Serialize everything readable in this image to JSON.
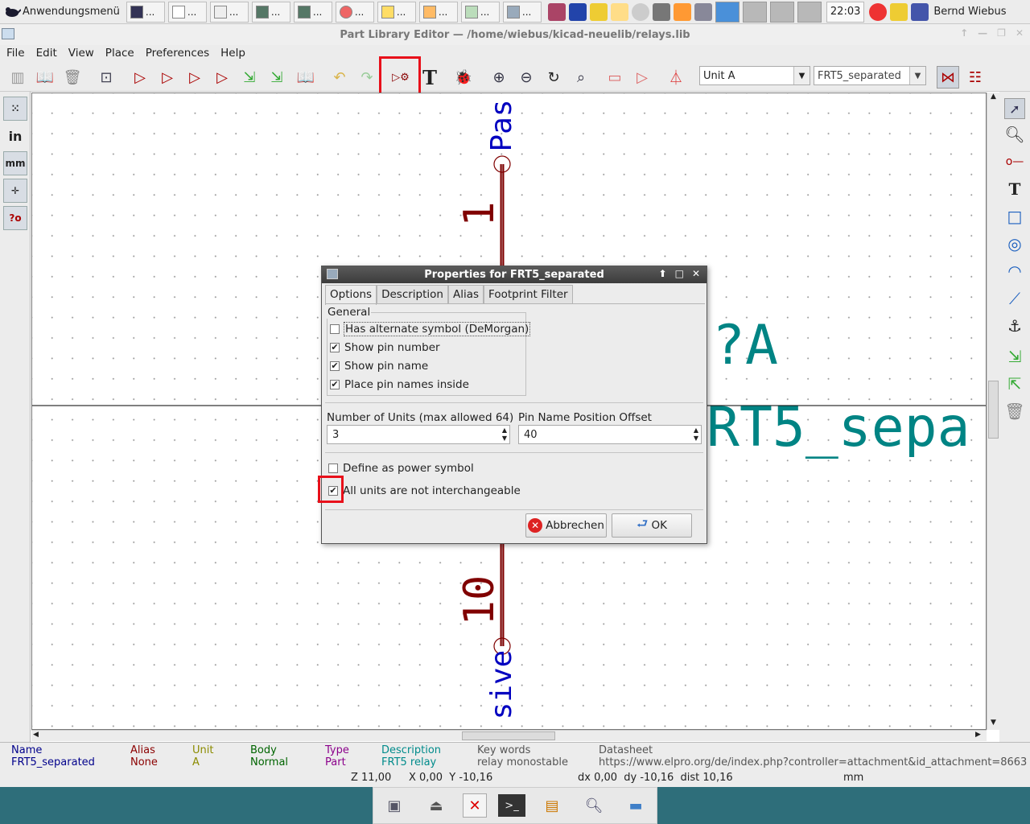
{
  "panel": {
    "app_menu": "Anwendungsmenü",
    "task_buttons": [
      "...",
      "...",
      "...",
      "...",
      "...",
      "...",
      "...",
      "...",
      "...",
      "..."
    ],
    "clock": "22:03",
    "user": "Bernd Wiebus"
  },
  "window": {
    "title": "Part Library Editor — /home/wiebus/kicad-neuelib/relays.lib"
  },
  "menu": [
    "File",
    "Edit",
    "View",
    "Place",
    "Preferences",
    "Help"
  ],
  "toolbar": {
    "unit_select": "Unit A",
    "part_select": "FRT5_separated"
  },
  "canvas": {
    "pin_top_number": "1",
    "pin_top_name": "Pas",
    "pin_bottom_number": "10",
    "pin_bottom_name": "sive",
    "ref_text": "?A",
    "value_text": "RT5_sepa"
  },
  "dialog": {
    "title": "Properties for FRT5_separated",
    "tabs": [
      "Options",
      "Description",
      "Alias",
      "Footprint Filter"
    ],
    "general_label": "General",
    "checks": [
      {
        "label": "Has alternate symbol (DeMorgan)",
        "checked": false
      },
      {
        "label": "Show pin number",
        "checked": true
      },
      {
        "label": "Show pin name",
        "checked": true
      },
      {
        "label": "Place pin names inside",
        "checked": true
      }
    ],
    "units_label": "Number of Units (max allowed 64)",
    "units_value": "3",
    "offset_label": "Pin Name Position Offset",
    "offset_value": "40",
    "power_label": "Define as power symbol",
    "power_checked": false,
    "interchange_label": "All units are not interchangeable",
    "interchange_checked": true,
    "cancel_label": "Abbrechen",
    "ok_label": "OK"
  },
  "status": {
    "columns": [
      {
        "head": "Name",
        "value": "FRT5_separated",
        "color": "#00008b"
      },
      {
        "head": "Alias",
        "value": "None",
        "color": "#8b0000"
      },
      {
        "head": "Unit",
        "value": "A",
        "color": "#8b8b00"
      },
      {
        "head": "Body",
        "value": "Normal",
        "color": "#006400"
      },
      {
        "head": "Type",
        "value": "Part",
        "color": "#8b008b"
      },
      {
        "head": "Description",
        "value": "FRT5 relay",
        "color": "#008b8b"
      },
      {
        "head": "Key words",
        "value": "relay monostable",
        "color": "#555555"
      },
      {
        "head": "Datasheet",
        "value": "https://www.elpro.org/de/index.php?controller=attachment&id_attachment=8663",
        "color": "#555555"
      }
    ],
    "zoom": "Z 11,00",
    "xy": "X 0,00  Y -10,16",
    "delta": "dx 0,00  dy -10,16  dist 10,16",
    "units": "mm"
  },
  "colors": {
    "pin": "#800000",
    "pin_name": "#0000c0",
    "field": "#008484",
    "highlight": "#e8101a"
  }
}
